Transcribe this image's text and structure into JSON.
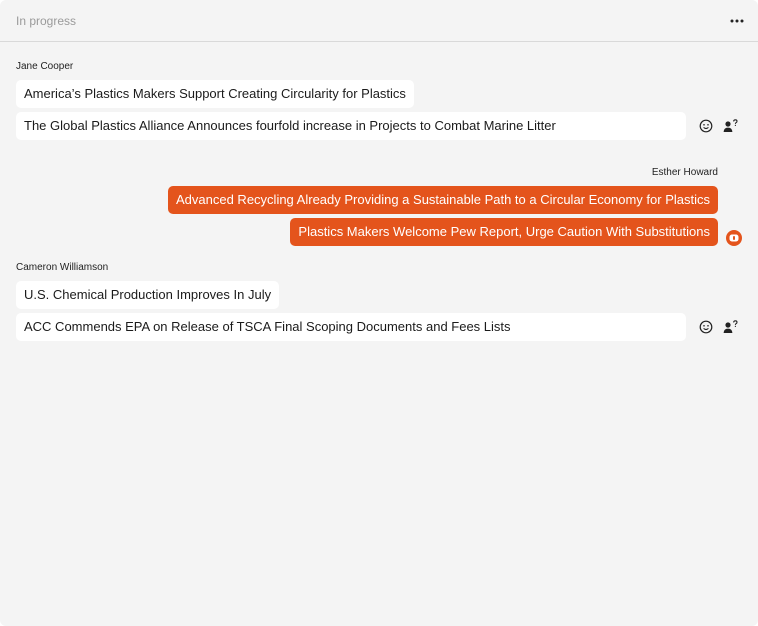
{
  "header": {
    "title": "In progress",
    "more_icon": "more-horizontal-icon"
  },
  "groups": [
    {
      "sender": "Jane Cooper",
      "direction": "in",
      "messages": [
        "America’s Plastics Makers Support Creating Circularity for Plastics",
        "The Global Plastics Alliance Announces fourfold increase in Projects to Combat Marine Litter"
      ]
    },
    {
      "sender": "Esther Howard",
      "direction": "out",
      "messages": [
        "Advanced Recycling Already Providing a Sustainable Path to a Circular Economy for Plastics",
        "Plastics Makers Welcome Pew Report, Urge Caution With Substitutions"
      ]
    },
    {
      "sender": "Cameron Williamson",
      "direction": "in",
      "messages": [
        "U.S. Chemical Production Improves In July",
        "ACC Commends EPA on Release of TSCA Final Scoping Documents and Fees Lists"
      ]
    }
  ],
  "colors": {
    "accent": "#e4541c",
    "bubble_in": "#ffffff",
    "panel": "#f4f4f4"
  }
}
